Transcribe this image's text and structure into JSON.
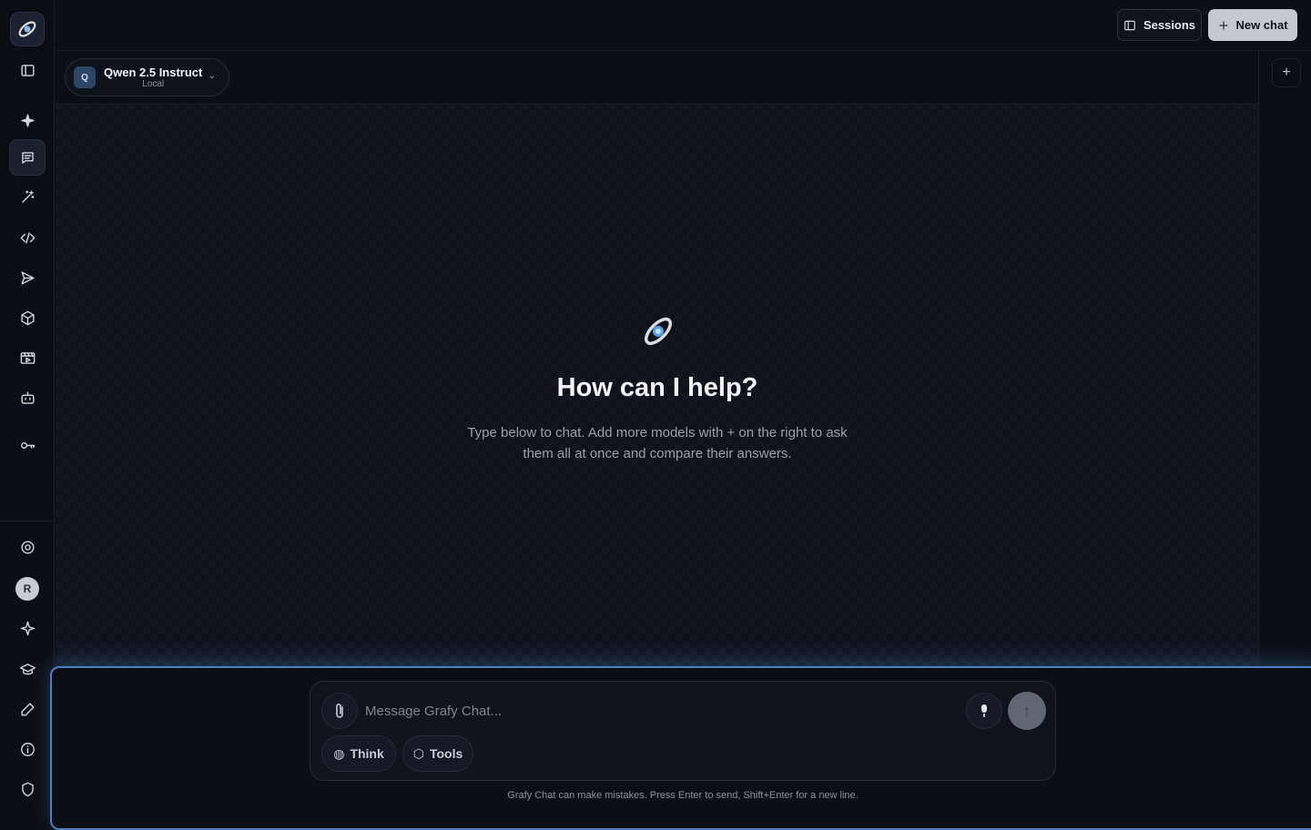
{
  "topbar": {
    "sessions_label": "Sessions",
    "new_chat_label": "New chat"
  },
  "model": {
    "badge": "Q",
    "name": "Qwen 2.5 Instruct",
    "sub": "Local",
    "caret": "⌄"
  },
  "hero": {
    "title": "How can I help?",
    "subtitle": "Type below to chat. Add more models with + on the right to ask them all at once and compare their answers."
  },
  "composer": {
    "placeholder": "Message Grafy Chat...",
    "think_label": "Think",
    "tools_label": "Tools",
    "disclaimer": "Grafy Chat can make mistakes. Press Enter to send, Shift+Enter for a new line."
  },
  "user": {
    "initial": "R"
  },
  "rail_icons": [
    "logo-icon",
    "sidebar-toggle-icon",
    "sparkle-icon",
    "chat-icon",
    "magic-wand-icon",
    "code-icon",
    "send-icon",
    "cube-icon",
    "film-icon",
    "robot-icon",
    "key-icon",
    "settings-icon",
    "avatar",
    "star-icon",
    "graduation-cap-icon",
    "pencil-icon",
    "info-icon",
    "shield-icon"
  ],
  "colors": {
    "accent": "#4a7fc4",
    "background": "#0b0e14",
    "new_chat_bg": "#c4c8cf"
  }
}
